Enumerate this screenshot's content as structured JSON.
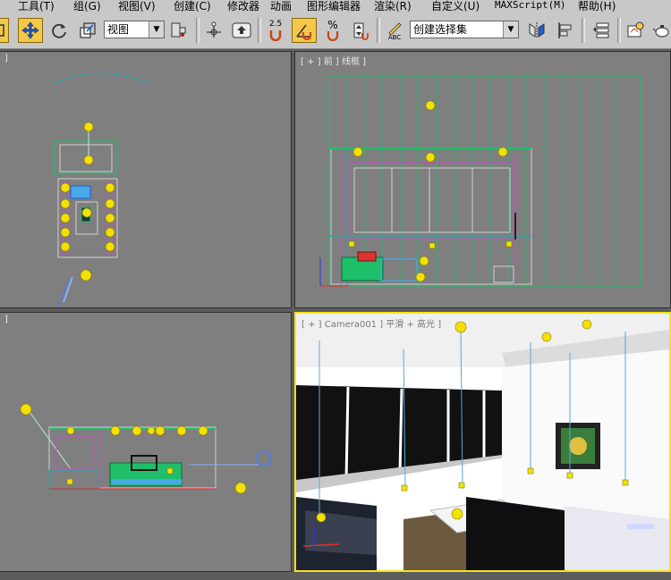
{
  "menu": {
    "items": [
      "工具(T)",
      "组(G)",
      "视图(V)",
      "创建(C)",
      "修改器",
      "动画",
      "图形编辑器",
      "渲染(R)",
      "自定义(U)",
      "MAXScript(M)",
      "帮助(H)"
    ]
  },
  "toolbar": {
    "view_dropdown": "视图",
    "snap_value": "2.5",
    "selection_set": "创建选择集",
    "abc_label": "ABC",
    "percent_label": "%"
  },
  "viewports": {
    "top_left": {
      "label": "]"
    },
    "front": {
      "label": "[ + ] 前 ] 线框 ]"
    },
    "left": {
      "label": "]"
    },
    "camera": {
      "label": "[ + ] Camera001 ] 平滑 + 高光 ]"
    }
  },
  "colors": {
    "ui_gray": "#c8c8c8",
    "viewport_bg": "#7f7f7f",
    "active_border": "#f7e31a",
    "light_yellow": "#f3e100",
    "wire_green": "#1fbf6a",
    "wire_teal": "#2aa4a4",
    "wire_magenta": "#c24fc2"
  }
}
